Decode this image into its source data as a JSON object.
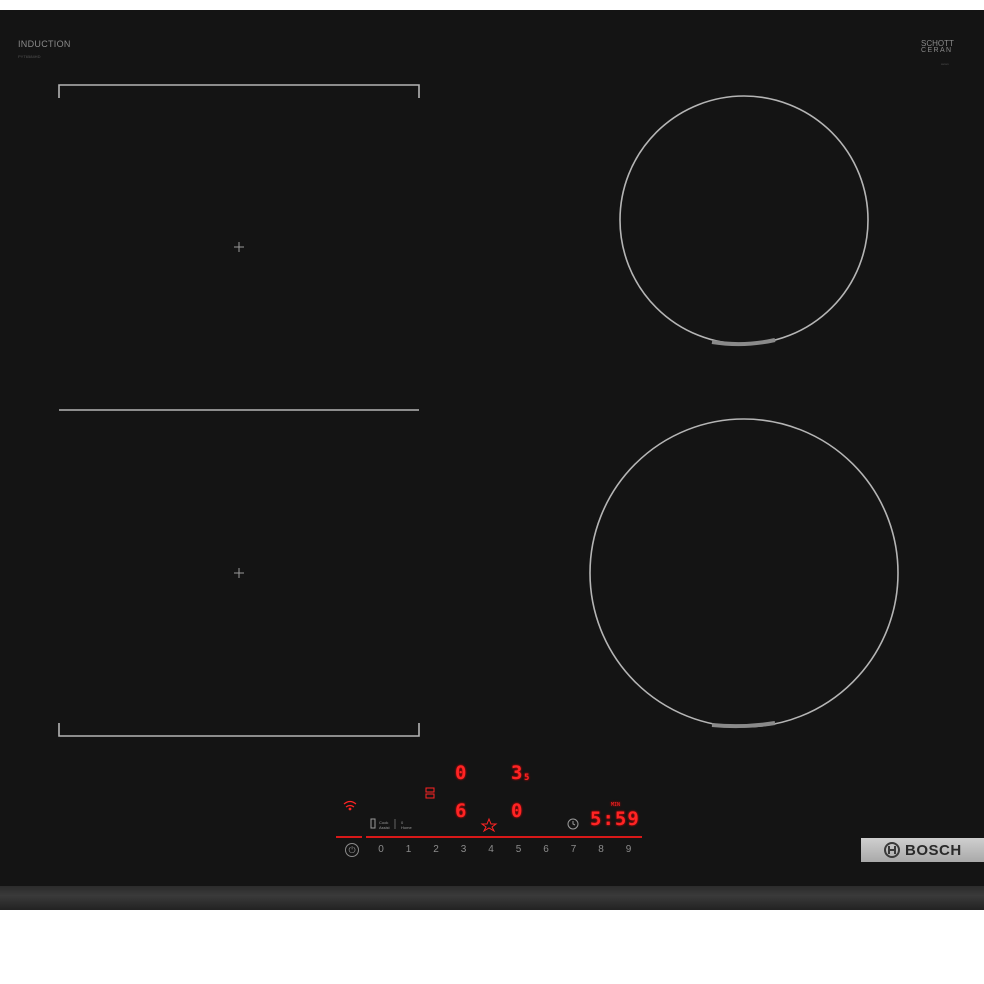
{
  "brand": {
    "top_left": "INDUCTION",
    "top_left_sub": "PYT6584HD",
    "top_right_line1": "SCHOTT",
    "top_right_line2": "CERAN",
    "top_right_sub": "ceran",
    "plate": "BOSCH"
  },
  "display": {
    "zone_rear_level": "0",
    "zone_right_level": "3",
    "zone_right_sub": "5",
    "zone_front_level": "6",
    "zone_front_right_level": "0",
    "timer_label": "MIN",
    "timer_value": "5:59",
    "boost_indicator": "△",
    "timer_icon": "clock-icon"
  },
  "controls": {
    "power_symbol": "⏻",
    "scale": [
      "0",
      "1",
      "2",
      "3",
      "4",
      "5",
      "6",
      "7",
      "8",
      "9"
    ],
    "small_label_1": "Cook",
    "small_label_1b": "Assist",
    "small_label_2": "0",
    "small_label_2b": "Home"
  },
  "colors": {
    "glass": "#141414",
    "display_red": "#ff2424",
    "zone_lines": "#b5b5b5"
  }
}
